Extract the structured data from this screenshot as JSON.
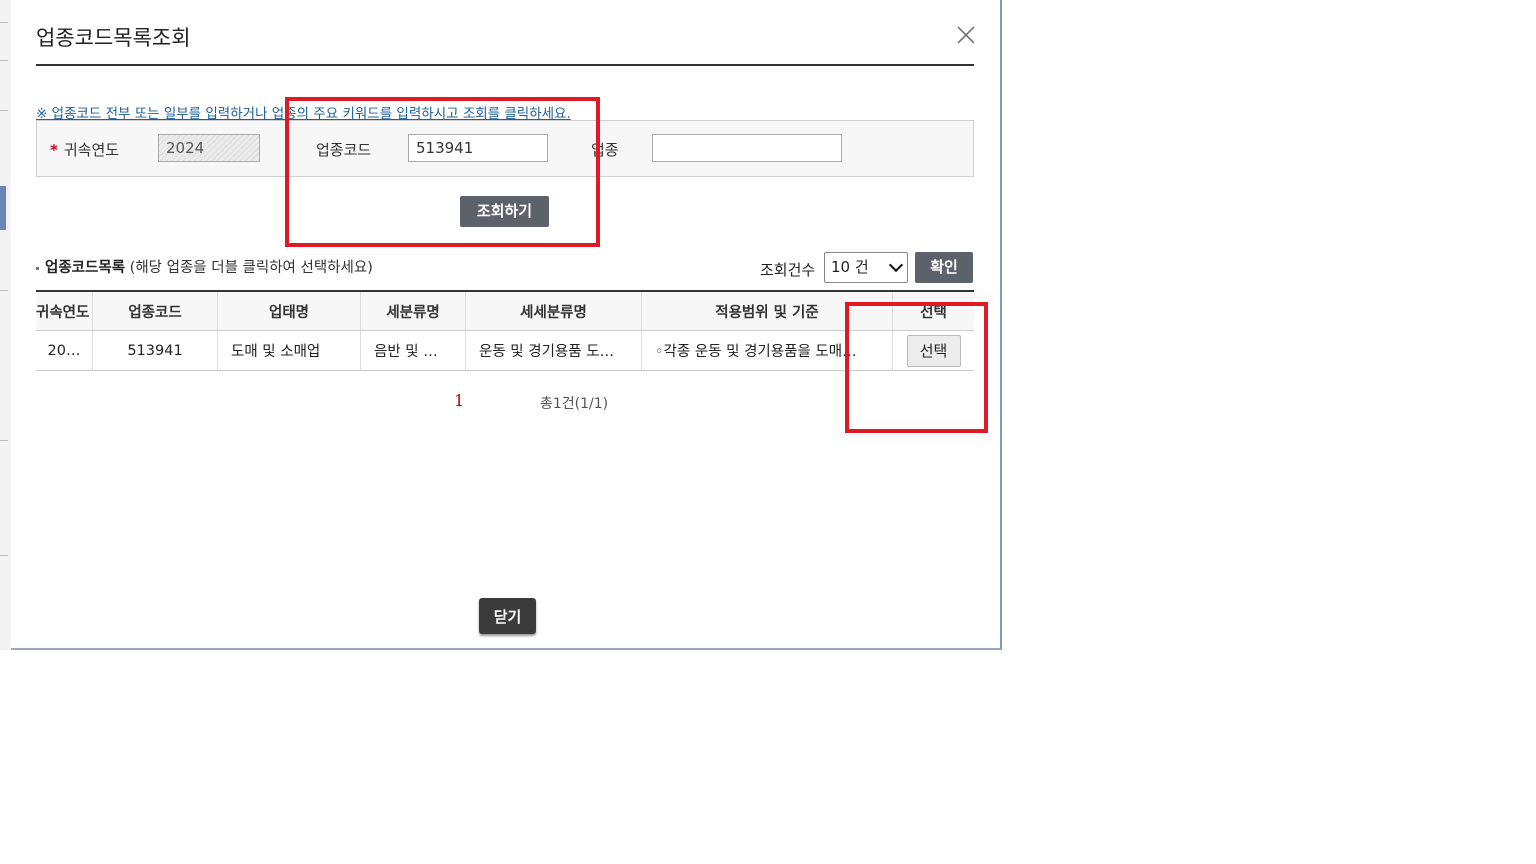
{
  "dialog": {
    "title": "업종코드목록조회",
    "hint": "※ 업종코드 전부 또는 일부를 입력하거나 업종의 주요 키워드를 입력하시고 조회를 클릭하세요.",
    "close_icon": "close-icon"
  },
  "search": {
    "year_required_mark": "*",
    "year_label": "귀속연도",
    "year_value": "2024",
    "code_label": "업종코드",
    "code_value": "513941",
    "industry_label": "업종",
    "industry_value": "",
    "search_button": "조회하기"
  },
  "list": {
    "title": "업종코드목록",
    "subtitle": "(해당 업종을 더블 클릭하여 선택하세요)",
    "count_label": "조회건수",
    "count_selected": "10 건",
    "confirm_button": "확인",
    "columns": [
      "귀속연도",
      "업종코드",
      "업태명",
      "세분류명",
      "세세분류명",
      "적용범위 및 기준",
      "선택"
    ],
    "rows": [
      {
        "year": "20…",
        "code": "513941",
        "business_type": "도매 및 소매업",
        "sub_class": "음반 및 …",
        "detail_class": "운동 및 경기용품 도…",
        "scope": "◦각종 운동 및 경기용품을 도매…",
        "select_label": "선택"
      }
    ]
  },
  "pagination": {
    "current_page": "1",
    "total": "총1건(1/1)"
  },
  "footer": {
    "close_button": "닫기"
  },
  "colors": {
    "annotation_red": "#e01a24",
    "link_blue": "#1b5f9e",
    "dark_button": "#5d6169"
  }
}
